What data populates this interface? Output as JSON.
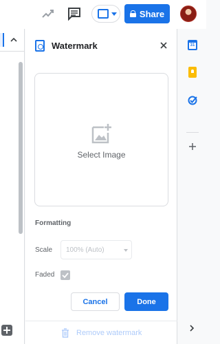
{
  "topbar": {
    "trend_icon": "trending-icon",
    "comment_icon": "comment-history-icon",
    "present_icon": "present-icon",
    "share_label": "Share",
    "share_icon": "lock-icon",
    "avatar_icon": "user-avatar"
  },
  "panel": {
    "title": "Watermark",
    "header_icon": "watermark-doc-icon",
    "close_icon": "close-icon",
    "image_picker": {
      "icon": "add-image-icon",
      "label": "Select Image"
    },
    "formatting": {
      "title": "Formatting",
      "scale_label": "Scale",
      "scale_value": "100% (Auto)",
      "faded_label": "Faded",
      "faded_checked": true
    },
    "buttons": {
      "cancel": "Cancel",
      "done": "Done"
    },
    "remove": {
      "icon": "trash-icon",
      "label": "Remove watermark"
    }
  },
  "rightbar": {
    "calendar_icon": "calendar-icon",
    "calendar_day": "31",
    "keep_icon": "keep-icon",
    "tasks_icon": "tasks-icon",
    "add_icon": "add-icon",
    "expand_icon": "chevron-right-icon"
  },
  "colors": {
    "accent": "#1a73e8",
    "keep": "#fbbc04",
    "disabled_text": "#bdc1c6",
    "disabled_link": "#aecbfa"
  }
}
